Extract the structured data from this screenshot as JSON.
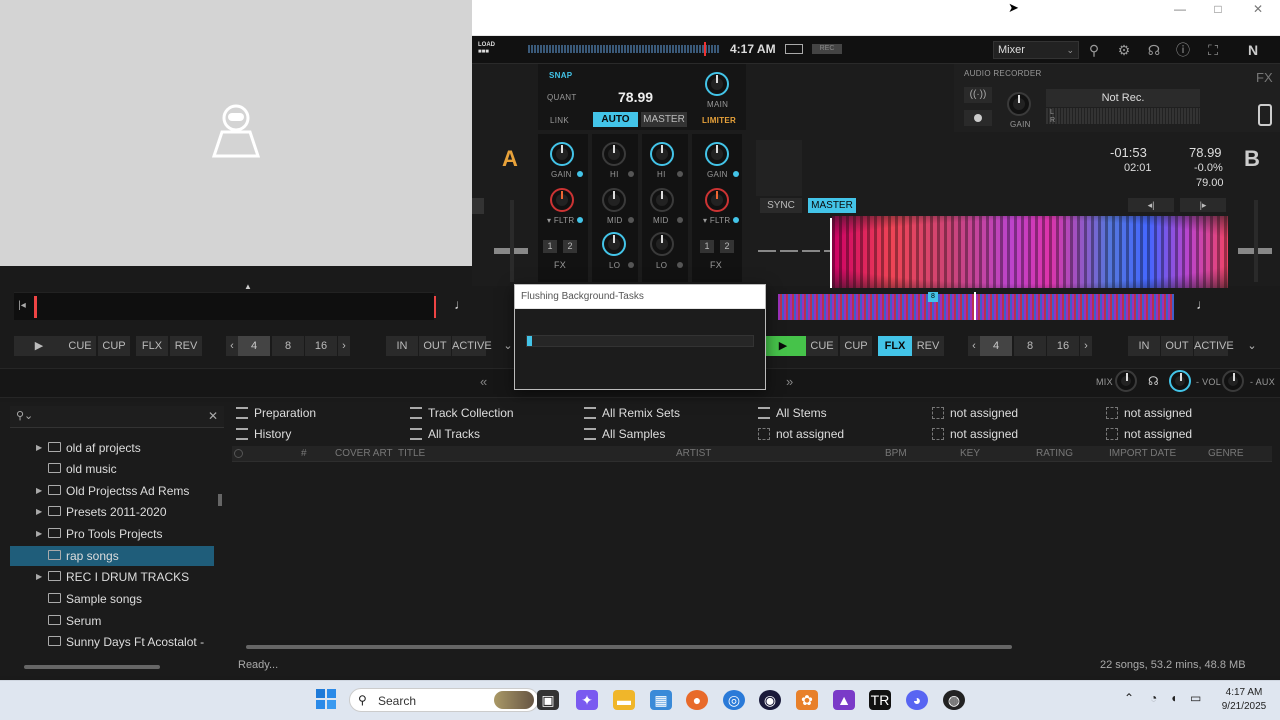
{
  "header": {
    "clock": "4:17 AM",
    "layout": "Mixer",
    "fx_label": "FX"
  },
  "mixer": {
    "snap": "SNAP",
    "quant": "QUANT",
    "bpm": "78.99",
    "link": "LINK",
    "auto": "AUTO",
    "master": "MASTER",
    "main": "MAIN",
    "limiter": "LIMITER",
    "gain": "GAIN",
    "hi": "HI",
    "mid": "MID",
    "lo": "LO",
    "fltr": "FLTR",
    "fx": "FX",
    "one": "1",
    "two": "2"
  },
  "recorder": {
    "title": "AUDIO RECORDER",
    "status": "Not Rec.",
    "gain": "GAIN",
    "l": "L",
    "r": "R"
  },
  "deckA": {
    "letter": "A",
    "buttons": [
      "CUE",
      "CUP",
      "FLX",
      "REV"
    ],
    "loops": [
      "4",
      "8",
      "16"
    ],
    "inout": [
      "IN",
      "OUT",
      "ACTIVE"
    ]
  },
  "deckB": {
    "letter": "B",
    "remaining": "-01:53",
    "elapsed": "02:01",
    "bpm": "78.99",
    "pitch": "-0.0%",
    "base_bpm": "79.00",
    "sync": "SYNC",
    "master": "MASTER",
    "buttons": [
      "CUE",
      "CUP",
      "FLX",
      "REV"
    ],
    "loops": [
      "4",
      "8",
      "16"
    ],
    "inout": [
      "IN",
      "OUT",
      "ACTIVE"
    ],
    "cue_marker": "8"
  },
  "bar2": {
    "mix": "MIX",
    "vol": "VOL",
    "aux": "AUX"
  },
  "dialog": {
    "title": "Flushing Background-Tasks",
    "progress": 0.02
  },
  "browser": {
    "tree": [
      {
        "label": "old af projects",
        "expandable": true
      },
      {
        "label": "old music",
        "expandable": false
      },
      {
        "label": "Old Projectss Ad Rems",
        "expandable": true
      },
      {
        "label": "Presets 2011-2020",
        "expandable": true
      },
      {
        "label": "Pro Tools Projects",
        "expandable": true
      },
      {
        "label": "rap songs",
        "expandable": false,
        "selected": true
      },
      {
        "label": "REC I DRUM TRACKS",
        "expandable": true
      },
      {
        "label": "Sample songs",
        "expandable": false
      },
      {
        "label": "Serum",
        "expandable": false
      },
      {
        "label": "Sunny Days Ft Acostalot -",
        "expandable": false
      }
    ],
    "favorites": [
      [
        "Preparation",
        "Track Collection",
        "All Remix Sets",
        "All Stems",
        "not assigned",
        "not assigned"
      ],
      [
        "History",
        "All Tracks",
        "All Samples",
        "not assigned",
        "not assigned",
        "not assigned"
      ]
    ],
    "columns": [
      "#",
      "COVER ART",
      "TITLE",
      "ARTIST",
      "BPM",
      "KEY",
      "RATING",
      "IMPORT DATE",
      "GENRE"
    ],
    "status_left": "Ready...",
    "status_right": "22 songs, 53.2 mins, 48.8 MB"
  },
  "taskbar": {
    "search": "Search",
    "time": "4:17 AM",
    "date": "9/21/2025"
  }
}
